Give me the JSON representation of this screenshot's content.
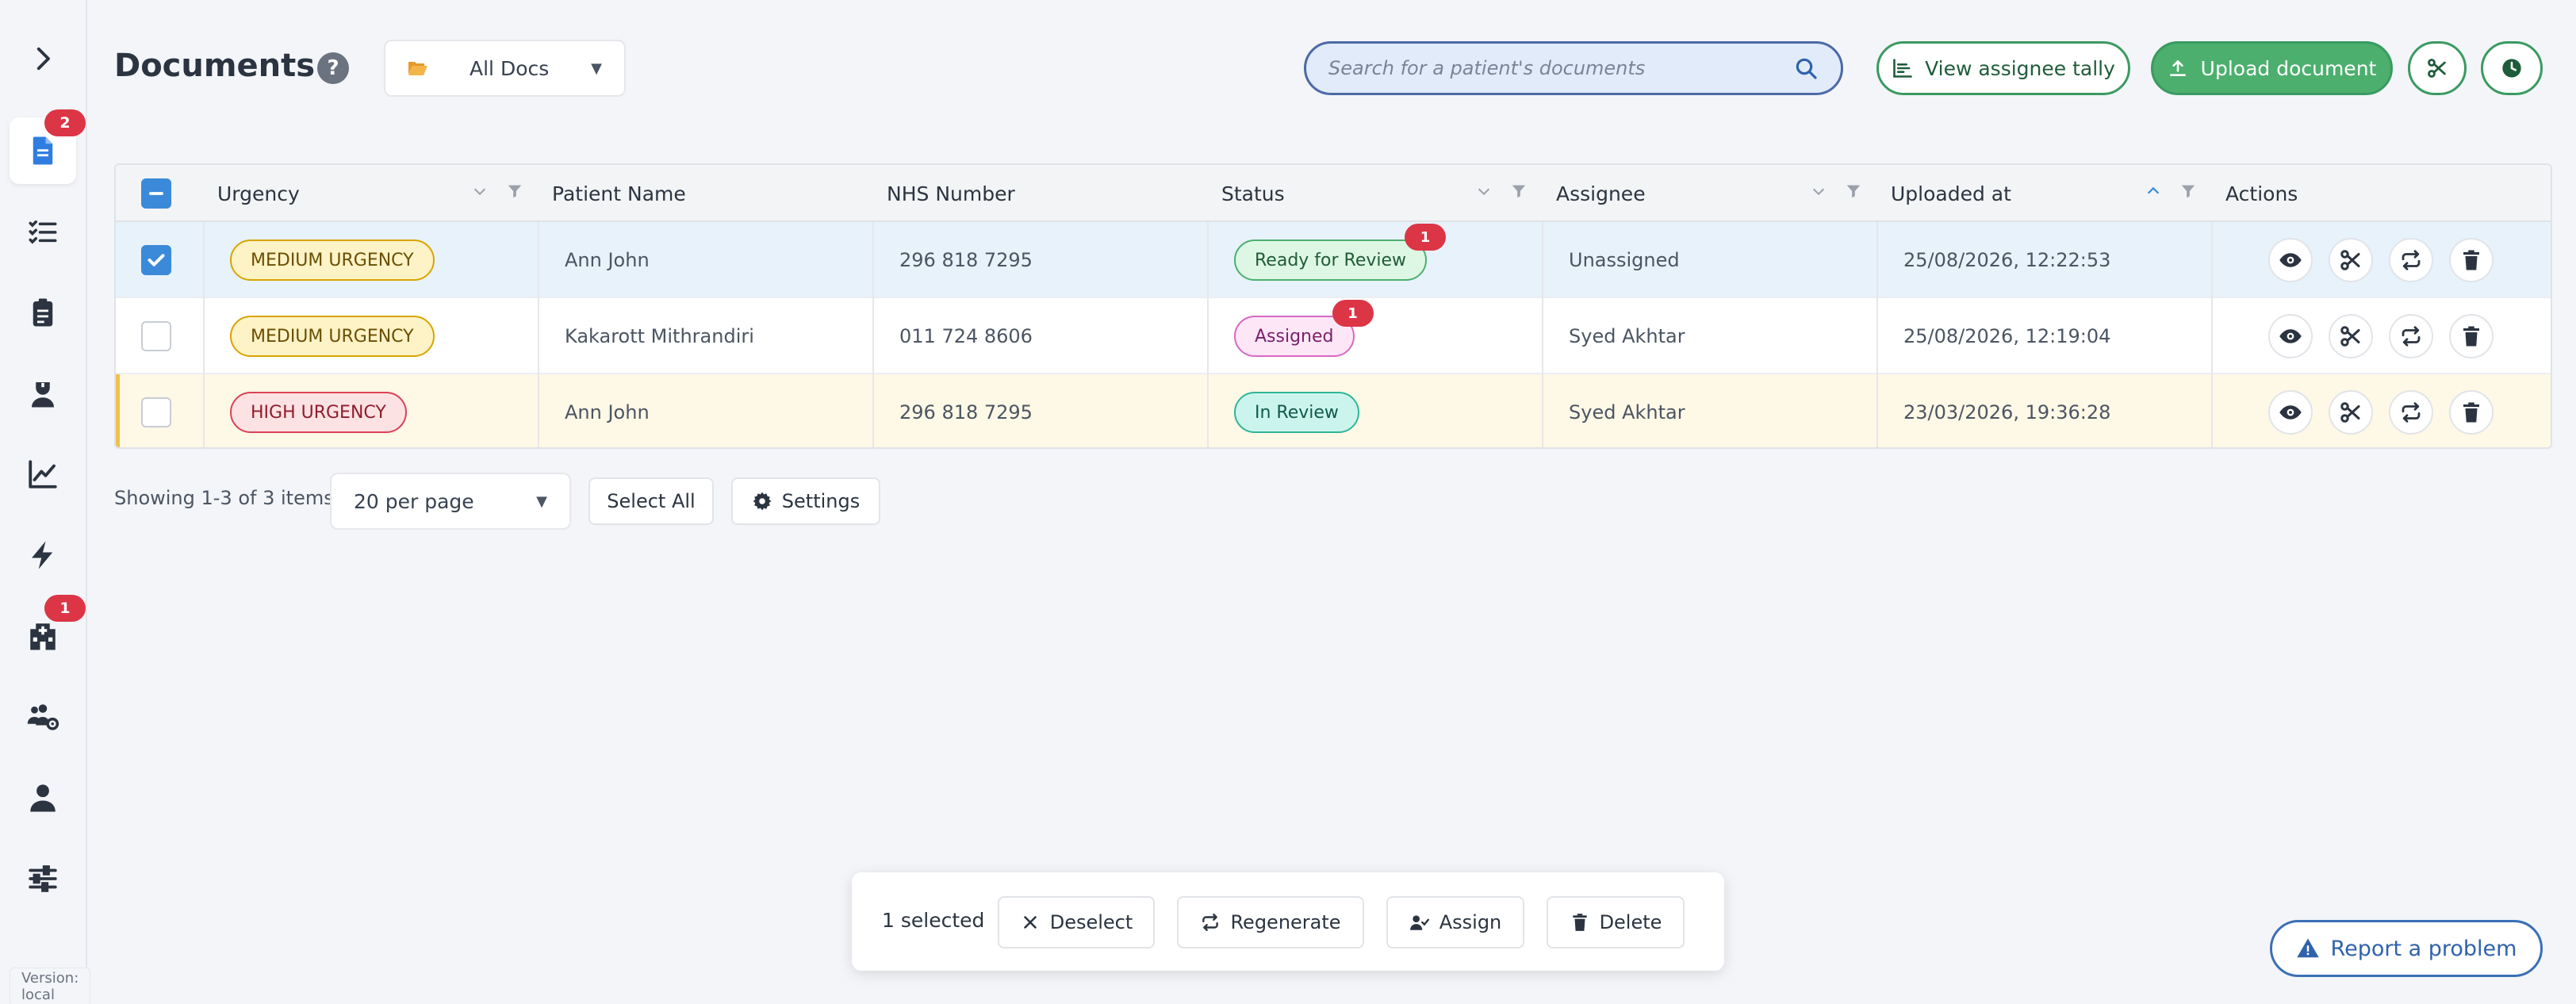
{
  "sidebar": {
    "items": [
      {
        "name": "expand",
        "icon": "chevron-right-icon"
      },
      {
        "name": "documents",
        "icon": "document-icon",
        "badge": "2"
      },
      {
        "name": "tasks",
        "icon": "checklist-icon"
      },
      {
        "name": "clipboard",
        "icon": "clipboard-icon"
      },
      {
        "name": "staff",
        "icon": "nurse-icon"
      },
      {
        "name": "analytics",
        "icon": "chart-line-icon"
      },
      {
        "name": "automation",
        "icon": "lightning-icon"
      },
      {
        "name": "hospital",
        "icon": "hospital-icon",
        "badge": "1"
      },
      {
        "name": "team",
        "icon": "users-gear-icon"
      },
      {
        "name": "profile",
        "icon": "user-icon"
      },
      {
        "name": "settings",
        "icon": "sliders-icon"
      }
    ],
    "version": "Version: local"
  },
  "header": {
    "title": "Documents",
    "help": "?",
    "doc_filter": "All Docs",
    "search_placeholder": "Search for a patient's documents",
    "tally_label": "View assignee tally",
    "upload_label": "Upload document"
  },
  "table": {
    "columns": [
      "Urgency",
      "Patient Name",
      "NHS Number",
      "Status",
      "Assignee",
      "Uploaded at",
      "Actions"
    ],
    "rows": [
      {
        "urgency": "MEDIUM URGENCY",
        "patient": "Ann John",
        "nhs": "296 818 7295",
        "status": "Ready for Review",
        "status_badge": "1",
        "assignee": "Unassigned",
        "uploaded": "25/08/2026, 12:22:53"
      },
      {
        "urgency": "MEDIUM URGENCY",
        "patient": "Kakarott Mithrandiri",
        "nhs": "011 724 8606",
        "status": "Assigned",
        "status_badge": "1",
        "assignee": "Syed Akhtar",
        "uploaded": "25/08/2026, 12:19:04"
      },
      {
        "urgency": "HIGH URGENCY",
        "patient": "Ann John",
        "nhs": "296 818 7295",
        "status": "In Review",
        "status_badge": "",
        "assignee": "Syed Akhtar",
        "uploaded": "23/03/2026, 19:36:28"
      }
    ]
  },
  "pagination": {
    "showing": "Showing 1-3 of 3 items",
    "per_page": "20 per page",
    "select_all": "Select All",
    "settings": "Settings"
  },
  "selection_bar": {
    "count": "1 selected",
    "deselect": "Deselect",
    "regenerate": "Regenerate",
    "assign": "Assign",
    "delete": "Delete"
  },
  "report": "Report a problem",
  "colors": {
    "accent_green": "#4caf6e",
    "accent_blue": "#3b8ad9",
    "danger": "#dc3545"
  }
}
